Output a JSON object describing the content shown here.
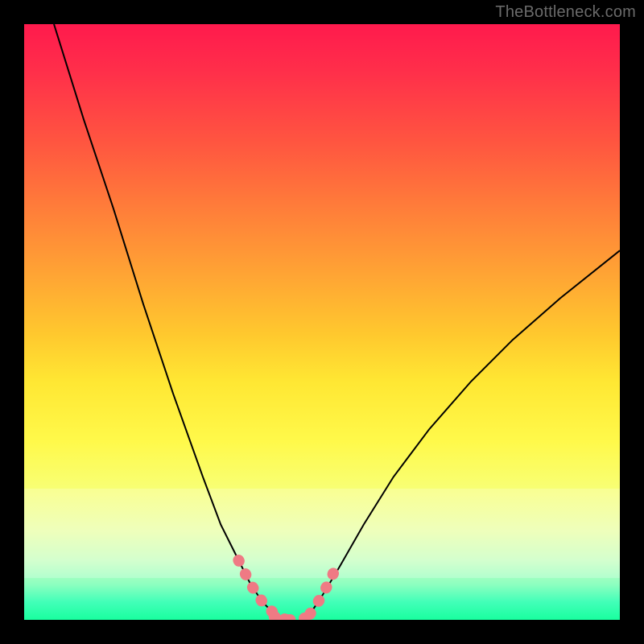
{
  "watermark": "TheBottleneck.com",
  "chart_data": {
    "type": "line",
    "title": "",
    "xlabel": "",
    "ylabel": "",
    "xlim": [
      0,
      100
    ],
    "ylim": [
      0,
      100
    ],
    "grid": false,
    "legend": false,
    "series": [
      {
        "name": "left-curve",
        "x": [
          5,
          10,
          15,
          20,
          25,
          30,
          33,
          36,
          38,
          40,
          42
        ],
        "values": [
          100,
          84,
          69,
          53,
          38,
          24,
          16,
          10,
          6,
          3,
          1
        ]
      },
      {
        "name": "right-curve",
        "x": [
          48,
          50,
          53,
          57,
          62,
          68,
          75,
          82,
          90,
          100
        ],
        "values": [
          1,
          4,
          9,
          16,
          24,
          32,
          40,
          47,
          54,
          62
        ]
      },
      {
        "name": "left-pink-segment",
        "x": [
          36,
          38,
          40,
          42,
          44
        ],
        "values": [
          10,
          6,
          3,
          1,
          0
        ]
      },
      {
        "name": "bottom-pink-segment",
        "x": [
          42,
          44,
          46,
          48
        ],
        "values": [
          0.5,
          0,
          0,
          0.5
        ]
      },
      {
        "name": "right-pink-segment",
        "x": [
          48,
          50,
          52
        ],
        "values": [
          1,
          4,
          8
        ]
      }
    ],
    "annotations": []
  },
  "background_gradient": {
    "top": "#ff1a4d",
    "mid": "#ffe733",
    "bottom": "#19ff9f"
  },
  "highlight_band": {
    "top_pct": 78,
    "bottom_pct": 93
  },
  "curve_styles": {
    "black_stroke": "#000000",
    "black_width": 2,
    "pink_stroke": "#ef7a84",
    "pink_width": 14,
    "pink_dash": "1 18"
  }
}
